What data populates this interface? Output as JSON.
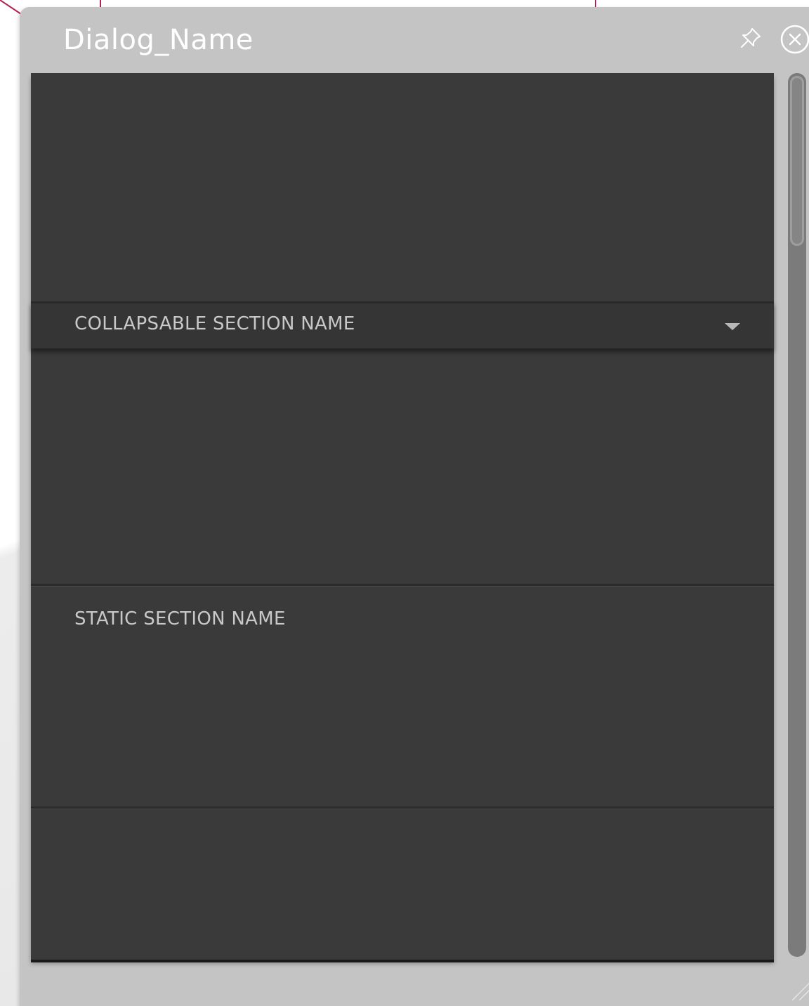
{
  "dialog": {
    "title": "Dialog_Name"
  },
  "sections": {
    "collapsable_label": "COLLAPSABLE SECTION NAME",
    "static_label": "STATIC SECTION NAME"
  },
  "icons": {
    "pin": "pin-icon",
    "close": "close-icon",
    "collapse": "chevron-down-icon",
    "resize": "resize-grip-icon"
  },
  "colors": {
    "callout": "#b0244f",
    "dialog_frame": "#c4c4c4",
    "content_bg": "#3a3a3a",
    "title_text": "#ffffff",
    "section_text": "#c8c8c8"
  }
}
